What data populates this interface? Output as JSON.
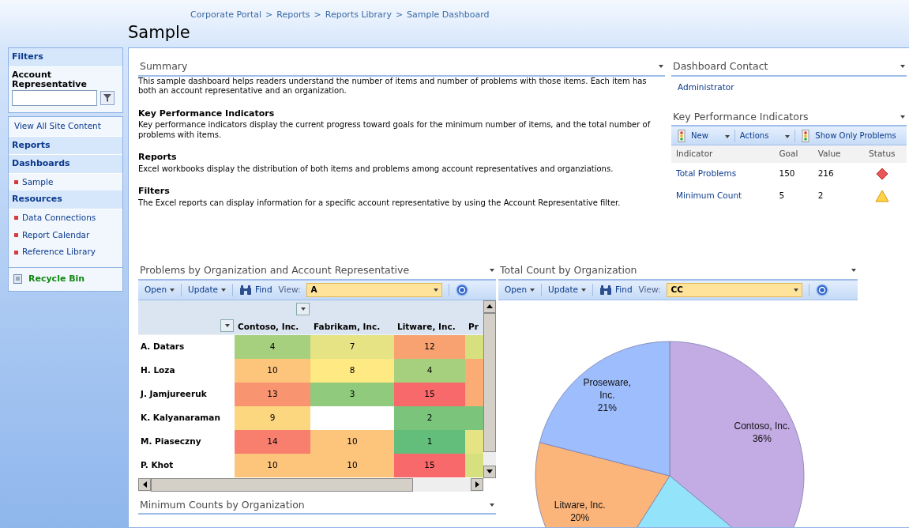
{
  "breadcrumb": {
    "separator": ">",
    "items": [
      "Corporate Portal",
      "Reports",
      "Reports Library",
      "Sample Dashboard"
    ]
  },
  "page_title": "Sample",
  "filters": {
    "title": "Filters",
    "label": "Account Representative"
  },
  "nav": [
    {
      "kind": "link",
      "label": "View All Site Content"
    },
    {
      "kind": "heading",
      "label": "Reports"
    },
    {
      "kind": "heading",
      "label": "Dashboards"
    },
    {
      "kind": "item",
      "label": "Sample"
    },
    {
      "kind": "heading",
      "label": "Resources"
    },
    {
      "kind": "item",
      "label": "Data Connections"
    },
    {
      "kind": "item",
      "label": "Report Calendar"
    },
    {
      "kind": "item",
      "label": "Reference Library"
    },
    {
      "kind": "recycle",
      "label": "Recycle Bin"
    }
  ],
  "summary": {
    "title": "Summary",
    "sections": [
      {
        "text": "This sample dashboard helps readers understand the number of items and number of problems with those items. Each item has both an account representative and an organization."
      },
      {
        "heading": "Key Performance Indicators",
        "text": "Key performance indicators display the current progress toward goals for the minimum number of items, and the total number of problems with items."
      },
      {
        "heading": "Reports",
        "text": "Excel workbooks display the distribution of both items and problems among account representatives and organziations."
      },
      {
        "heading": "Filters",
        "text": "The Excel reports can display information for a specific account representative by using the Account Representative filter."
      }
    ]
  },
  "contact": {
    "title": "Dashboard Contact",
    "name": "Administrator"
  },
  "kpi": {
    "title": "Key Performance Indicators",
    "toolbar": {
      "new": "New",
      "actions": "Actions",
      "filter": "Show Only Problems"
    },
    "columns": [
      "Indicator",
      "Goal",
      "Value",
      "Status"
    ],
    "rows": [
      {
        "name": "Total Problems",
        "goal": "150",
        "value": "216",
        "kind": "diamond"
      },
      {
        "name": "Minimum Count",
        "goal": "5",
        "value": "2",
        "kind": "triangle"
      }
    ]
  },
  "heatmap_part": {
    "title": "Problems by Organization and Account Representative",
    "toolbar": {
      "open": "Open",
      "update": "Update",
      "find": "Find",
      "view_label": "View:",
      "view": "A"
    },
    "columns": [
      "Contoso, Inc.",
      "Fabrikam, Inc.",
      "Litware, Inc.",
      "Pr"
    ],
    "rows": [
      {
        "name": "A. Datars",
        "cells": [
          {
            "text": "4",
            "color": "#a7d07e"
          },
          {
            "text": "7",
            "color": "#e6e384"
          },
          {
            "text": "12",
            "color": "#f8a272"
          },
          {
            "color": "#d6e07f"
          }
        ]
      },
      {
        "name": "H. Loza",
        "cells": [
          {
            "text": "10",
            "color": "#fdc47c"
          },
          {
            "text": "8",
            "color": "#fee983"
          },
          {
            "text": "4",
            "color": "#a7d07e"
          },
          {
            "color": "#fbab74"
          }
        ]
      },
      {
        "name": "J. Jamjureeruk",
        "cells": [
          {
            "text": "13",
            "color": "#f89470"
          },
          {
            "text": "3",
            "color": "#90cb7d"
          },
          {
            "text": "15",
            "color": "#f8696b"
          },
          {
            "color": "#fbab74"
          }
        ]
      },
      {
        "name": "K. Kalyanaraman",
        "cells": [
          {
            "text": "9",
            "color": "#fdd780"
          },
          null,
          {
            "text": "2",
            "color": "#7bc47c"
          },
          {
            "color": "#7bc47c"
          }
        ]
      },
      {
        "name": "M. Piaseczny",
        "cells": [
          {
            "text": "14",
            "color": "#f87f6e"
          },
          {
            "text": "10",
            "color": "#fdc47c"
          },
          {
            "text": "1",
            "color": "#63be7b"
          },
          {
            "color": "#e6e384"
          }
        ]
      },
      {
        "name": "P. Khot",
        "cells": [
          {
            "text": "10",
            "color": "#fdc47c"
          },
          {
            "text": "10",
            "color": "#fdc47c"
          },
          {
            "text": "15",
            "color": "#f8696b"
          },
          {
            "color": "#d6e07f"
          }
        ]
      }
    ]
  },
  "pie_part": {
    "title": "Total Count by Organization",
    "toolbar": {
      "open": "Open",
      "update": "Update",
      "find": "Find",
      "view_label": "View:",
      "view": "CC"
    },
    "chart_data": {
      "type": "pie",
      "categories": [
        "Contoso, Inc.",
        null,
        "Litware, Inc.",
        "Proseware, Inc."
      ],
      "values": [
        36,
        23,
        20,
        21
      ],
      "colors": [
        "#c3abe3",
        "#93e3fa",
        "#fbb47a",
        "#9dbdfd"
      ],
      "value_labels": [
        "36%",
        null,
        "20%",
        "21%"
      ]
    }
  },
  "bottom_part": {
    "title": "Minimum Counts by Organization"
  }
}
